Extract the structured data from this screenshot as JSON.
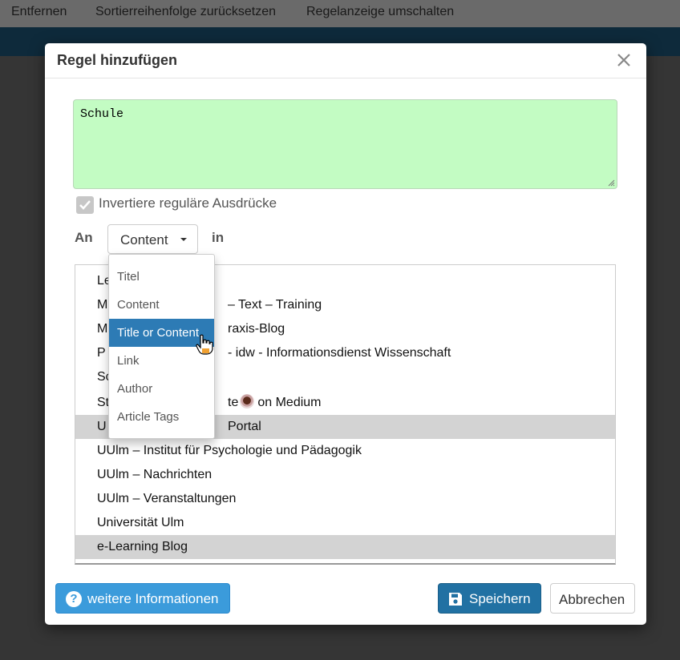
{
  "topbar": {
    "items": [
      "Entfernen",
      "Sortierreihenfolge zurücksetzen",
      "Regelanzeige umschalten"
    ]
  },
  "modal": {
    "title": "Regel hinzufügen",
    "close_icon": "close-icon"
  },
  "rule": {
    "regex_value": "Schule",
    "invert_checked": true,
    "invert_label": "Invertiere reguläre Ausdrücke",
    "an_label": "An",
    "in_label": "in",
    "field_selected": "Content"
  },
  "dropdown": {
    "options": [
      "Titel",
      "Content",
      "Title or Content",
      "Link",
      "Author",
      "Article Tags"
    ],
    "highlighted": "Title or Content"
  },
  "feeds": {
    "rows": [
      {
        "visible_text": "Le",
        "selected": false
      },
      {
        "visible_text": "M",
        "tail": "– Text – Training",
        "selected": false
      },
      {
        "visible_text": "M",
        "tail": "raxis-Blog",
        "selected": false
      },
      {
        "visible_text": "P",
        "tail": "- idw - Informationsdienst Wissenschaft",
        "selected": false
      },
      {
        "visible_text": "Sc",
        "selected": false
      },
      {
        "visible_text": "St",
        "tail": "te",
        "tail2": "on Medium",
        "selected": false
      },
      {
        "visible_text": "U",
        "tail": "Portal",
        "selected": true
      },
      {
        "visible_text": "UUlm – Institut für Psychologie und Pädagogik",
        "selected": false
      },
      {
        "visible_text": "UUlm – Nachrichten",
        "selected": false
      },
      {
        "visible_text": "UUlm – Veranstaltungen",
        "selected": false
      },
      {
        "visible_text": "Universität Ulm",
        "selected": false
      },
      {
        "visible_text": "e-Learning Blog",
        "selected": true
      }
    ]
  },
  "footer": {
    "info_label": "weitere Informationen",
    "save_label": "Speichern",
    "cancel_label": "Abbrechen"
  },
  "colors": {
    "regex_bg": "#c3fcc3",
    "active_option": "#2d7bb5",
    "info_button": "#3b9bdb",
    "save_button": "#2171a3",
    "header_bar": "#1d5577"
  }
}
